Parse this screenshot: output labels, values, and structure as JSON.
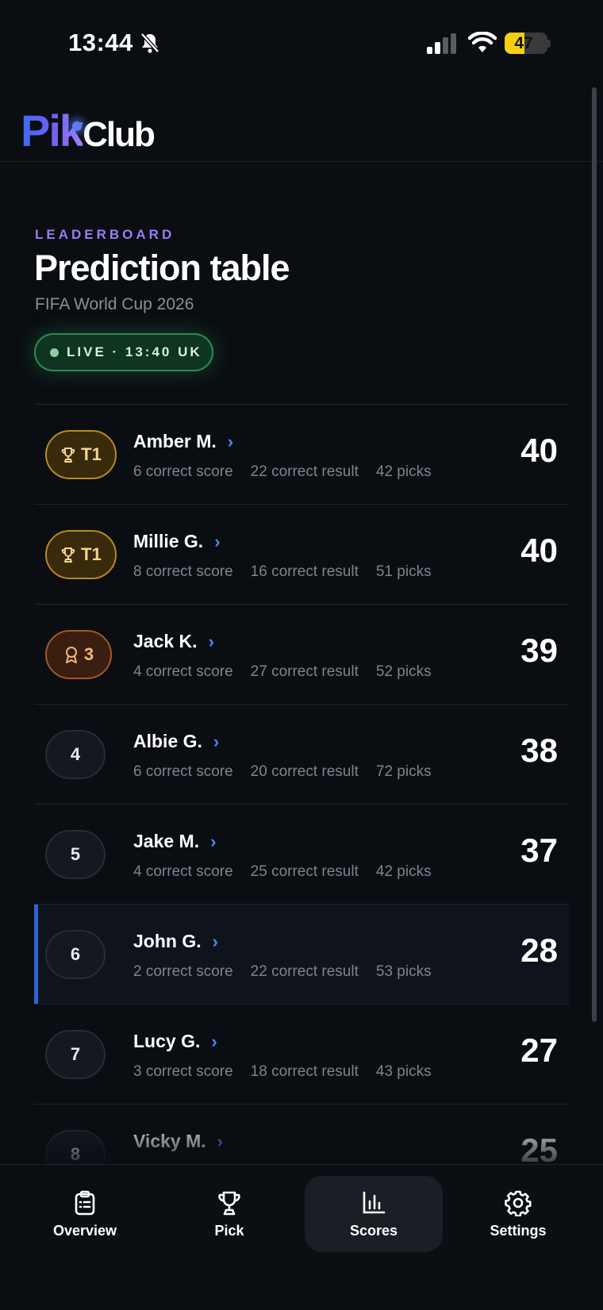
{
  "status_bar": {
    "time": "13:44",
    "battery": "47",
    "battery_level": 0.47
  },
  "header": {
    "logo_part1": "Pik",
    "logo_part2": "Club"
  },
  "page": {
    "eyebrow": "LEADERBOARD",
    "title": "Prediction table",
    "subtitle": "FIFA World Cup 2026",
    "live_label": "LIVE · 13:40 UK"
  },
  "leaderboard": [
    {
      "rank": "T1",
      "style": "gold",
      "icon": "trophy-icon",
      "name": "Amber M.",
      "correct_score": "6 correct score",
      "correct_result": "22 correct result",
      "picks": "42 picks",
      "points": "40",
      "me": false
    },
    {
      "rank": "T1",
      "style": "gold",
      "icon": "trophy-icon",
      "name": "Millie G.",
      "correct_score": "8 correct score",
      "correct_result": "16 correct result",
      "picks": "51 picks",
      "points": "40",
      "me": false
    },
    {
      "rank": "3",
      "style": "bronze",
      "icon": "medal-icon",
      "name": "Jack K.",
      "correct_score": "4 correct score",
      "correct_result": "27 correct result",
      "picks": "52 picks",
      "points": "39",
      "me": false
    },
    {
      "rank": "4",
      "style": "plain",
      "icon": "",
      "name": "Albie G.",
      "correct_score": "6 correct score",
      "correct_result": "20 correct result",
      "picks": "72 picks",
      "points": "38",
      "me": false
    },
    {
      "rank": "5",
      "style": "plain",
      "icon": "",
      "name": "Jake M.",
      "correct_score": "4 correct score",
      "correct_result": "25 correct result",
      "picks": "42 picks",
      "points": "37",
      "me": false
    },
    {
      "rank": "6",
      "style": "plain",
      "icon": "",
      "name": "John G.",
      "correct_score": "2 correct score",
      "correct_result": "22 correct result",
      "picks": "53 picks",
      "points": "28",
      "me": true
    },
    {
      "rank": "7",
      "style": "plain",
      "icon": "",
      "name": "Lucy G.",
      "correct_score": "3 correct score",
      "correct_result": "18 correct result",
      "picks": "43 picks",
      "points": "27",
      "me": false
    },
    {
      "rank": "8",
      "style": "plain",
      "icon": "",
      "name": "Vicky M.",
      "correct_score": "",
      "correct_result": "",
      "picks": "",
      "points": "25",
      "me": false
    }
  ],
  "bottom_nav": [
    {
      "label": "Overview",
      "icon": "clipboard-icon",
      "active": false
    },
    {
      "label": "Pick",
      "icon": "trophy-icon",
      "active": false
    },
    {
      "label": "Scores",
      "icon": "bar-chart-icon",
      "active": true
    },
    {
      "label": "Settings",
      "icon": "gear-icon",
      "active": false
    }
  ],
  "colors": {
    "accent_blue": "#4d86f7",
    "eyebrow_purple": "#9b7df5",
    "live_green": "#2b8c4f",
    "gold": "#b68a25",
    "bronze": "#a3582a"
  }
}
